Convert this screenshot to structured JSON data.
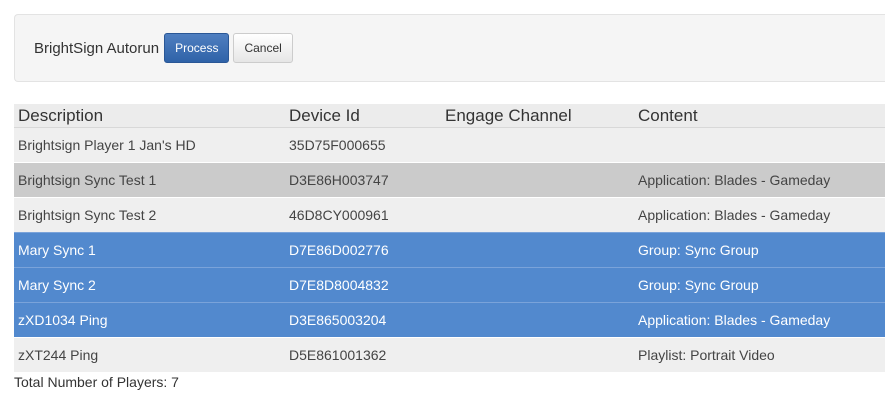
{
  "toolbar": {
    "title": "BrightSign Autorun",
    "process_label": "Process",
    "cancel_label": "Cancel"
  },
  "table": {
    "headers": [
      "Description",
      "Device Id",
      "Engage Channel",
      "Content"
    ],
    "rows": [
      {
        "description": "Brightsign Player 1 Jan's HD",
        "device_id": "35D75F000655",
        "engage_channel": "",
        "content": "",
        "state": "default"
      },
      {
        "description": "Brightsign Sync Test 1",
        "device_id": "D3E86H003747",
        "engage_channel": "",
        "content": "Application: Blades - Gameday",
        "state": "hover"
      },
      {
        "description": "Brightsign Sync Test 2",
        "device_id": "46D8CY000961",
        "engage_channel": "",
        "content": "Application: Blades - Gameday",
        "state": "default"
      },
      {
        "description": "Mary Sync 1",
        "device_id": "D7E86D002776",
        "engage_channel": "",
        "content": "Group: Sync Group",
        "state": "selected"
      },
      {
        "description": "Mary Sync 2",
        "device_id": "D7E8D8004832",
        "engage_channel": "",
        "content": "Group: Sync Group",
        "state": "selected"
      },
      {
        "description": "zXD1034 Ping",
        "device_id": "D3E865003204",
        "engage_channel": "",
        "content": "Application: Blades - Gameday",
        "state": "selected"
      },
      {
        "description": "zXT244 Ping",
        "device_id": "D5E861001362",
        "engage_channel": "",
        "content": "Playlist: Portrait Video",
        "state": "default"
      }
    ]
  },
  "footer": {
    "total_text": "Total Number of Players: 7"
  },
  "colors": {
    "selected_row": "#5289ce",
    "hover_row": "#cbcbcb",
    "default_row": "#efefef",
    "primary_button": "#3a6db3"
  }
}
